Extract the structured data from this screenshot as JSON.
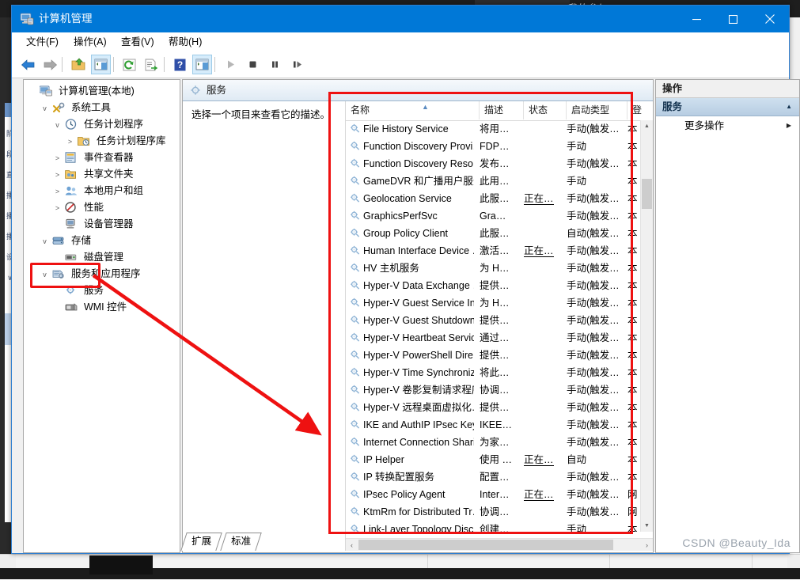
{
  "desktop": {
    "background_tab_label": "我的参与",
    "accent": "#0078d7",
    "annotation_color": "#ee1111"
  },
  "window": {
    "title": "计算机管理",
    "title_icon": "computer-management-icon",
    "controls": {
      "minimize": "—",
      "maximize": "▢",
      "close": "✕"
    }
  },
  "menu": [
    {
      "label": "文件(F)",
      "key": "F"
    },
    {
      "label": "操作(A)",
      "key": "A"
    },
    {
      "label": "查看(V)",
      "key": "V"
    },
    {
      "label": "帮助(H)",
      "key": "H"
    }
  ],
  "toolbar": [
    {
      "name": "back-icon",
      "glyph": "◀"
    },
    {
      "name": "forward-icon",
      "glyph": "▶"
    },
    {
      "name": "up-folder-icon",
      "glyph": ""
    },
    {
      "name": "show-hide-tree-icon",
      "glyph": "",
      "selected": true
    },
    {
      "name": "refresh-icon",
      "glyph": ""
    },
    {
      "name": "export-list-icon",
      "glyph": ""
    },
    {
      "name": "help-icon",
      "glyph": "?"
    },
    {
      "name": "properties-icon",
      "glyph": "",
      "selected": true
    },
    {
      "name": "start-service-icon",
      "glyph": "▶"
    },
    {
      "name": "stop-service-icon",
      "glyph": "■"
    },
    {
      "name": "pause-service-icon",
      "glyph": "❚❚"
    },
    {
      "name": "resume-service-icon",
      "glyph": "❚▶"
    }
  ],
  "tree": [
    {
      "label": "计算机管理(本地)",
      "indent": 0,
      "expander": "",
      "icon": "computer-icon",
      "selected": false
    },
    {
      "label": "系统工具",
      "indent": 1,
      "expander": "v",
      "icon": "system-tools-icon",
      "selected": false
    },
    {
      "label": "任务计划程序",
      "indent": 2,
      "expander": "v",
      "icon": "task-scheduler-icon",
      "selected": false
    },
    {
      "label": "任务计划程序库",
      "indent": 3,
      "expander": ">",
      "icon": "task-library-icon",
      "selected": false
    },
    {
      "label": "事件查看器",
      "indent": 2,
      "expander": ">",
      "icon": "event-viewer-icon",
      "selected": false
    },
    {
      "label": "共享文件夹",
      "indent": 2,
      "expander": ">",
      "icon": "shared-folders-icon",
      "selected": false
    },
    {
      "label": "本地用户和组",
      "indent": 2,
      "expander": ">",
      "icon": "local-users-icon",
      "selected": false
    },
    {
      "label": "性能",
      "indent": 2,
      "expander": ">",
      "icon": "performance-icon",
      "selected": false
    },
    {
      "label": "设备管理器",
      "indent": 2,
      "expander": "",
      "icon": "device-manager-icon",
      "selected": false
    },
    {
      "label": "存储",
      "indent": 1,
      "expander": "v",
      "icon": "storage-icon",
      "selected": false
    },
    {
      "label": "磁盘管理",
      "indent": 2,
      "expander": "",
      "icon": "disk-management-icon",
      "selected": false
    },
    {
      "label": "服务和应用程序",
      "indent": 1,
      "expander": "v",
      "icon": "services-apps-icon",
      "selected": false
    },
    {
      "label": "服务",
      "indent": 2,
      "expander": "",
      "icon": "services-icon",
      "selected": true
    },
    {
      "label": "WMI 控件",
      "indent": 2,
      "expander": "",
      "icon": "wmi-control-icon",
      "selected": false
    }
  ],
  "center": {
    "header_title": "服务",
    "header_icon": "services-icon",
    "description_placeholder": "选择一个项目来查看它的描述。"
  },
  "list": {
    "columns": [
      "名称",
      "描述",
      "状态",
      "启动类型",
      "登"
    ],
    "sort_column": "名称",
    "sort_direction": "asc",
    "rows": [
      {
        "name": "File History Service",
        "desc": "将用…",
        "status": "",
        "startup": "手动(触发…",
        "logon": "本"
      },
      {
        "name": "Function Discovery Provi…",
        "desc": "FDP…",
        "status": "",
        "startup": "手动",
        "logon": "本"
      },
      {
        "name": "Function Discovery Reso…",
        "desc": "发布…",
        "status": "",
        "startup": "手动(触发…",
        "logon": "本"
      },
      {
        "name": "GameDVR 和广播用户服务…",
        "desc": "此用…",
        "status": "",
        "startup": "手动",
        "logon": "本"
      },
      {
        "name": "Geolocation Service",
        "desc": "此服…",
        "status": "正在…",
        "startup": "手动(触发…",
        "logon": "本"
      },
      {
        "name": "GraphicsPerfSvc",
        "desc": "Gra…",
        "status": "",
        "startup": "手动(触发…",
        "logon": "本"
      },
      {
        "name": "Group Policy Client",
        "desc": "此服…",
        "status": "",
        "startup": "自动(触发…",
        "logon": "本"
      },
      {
        "name": "Human Interface Device …",
        "desc": "激活…",
        "status": "正在…",
        "startup": "手动(触发…",
        "logon": "本"
      },
      {
        "name": "HV 主机服务",
        "desc": "为 H…",
        "status": "",
        "startup": "手动(触发…",
        "logon": "本"
      },
      {
        "name": "Hyper-V Data Exchange …",
        "desc": "提供…",
        "status": "",
        "startup": "手动(触发…",
        "logon": "本"
      },
      {
        "name": "Hyper-V Guest Service In…",
        "desc": "为 H…",
        "status": "",
        "startup": "手动(触发…",
        "logon": "本"
      },
      {
        "name": "Hyper-V Guest Shutdown…",
        "desc": "提供…",
        "status": "",
        "startup": "手动(触发…",
        "logon": "本"
      },
      {
        "name": "Hyper-V Heartbeat Service",
        "desc": "通过…",
        "status": "",
        "startup": "手动(触发…",
        "logon": "本"
      },
      {
        "name": "Hyper-V PowerShell Dire…",
        "desc": "提供…",
        "status": "",
        "startup": "手动(触发…",
        "logon": "本"
      },
      {
        "name": "Hyper-V Time Synchroniz…",
        "desc": "将此…",
        "status": "",
        "startup": "手动(触发…",
        "logon": "本"
      },
      {
        "name": "Hyper-V 卷影复制请求程序",
        "desc": "协调…",
        "status": "",
        "startup": "手动(触发…",
        "logon": "本"
      },
      {
        "name": "Hyper-V 远程桌面虚拟化…",
        "desc": "提供…",
        "status": "",
        "startup": "手动(触发…",
        "logon": "本"
      },
      {
        "name": "IKE and AuthIP IPsec Key…",
        "desc": "IKEE…",
        "status": "",
        "startup": "手动(触发…",
        "logon": "本"
      },
      {
        "name": "Internet Connection Shari…",
        "desc": "为家…",
        "status": "",
        "startup": "手动(触发…",
        "logon": "本"
      },
      {
        "name": "IP Helper",
        "desc": "使用 …",
        "status": "正在…",
        "startup": "自动",
        "logon": "本"
      },
      {
        "name": "IP 转换配置服务",
        "desc": "配置…",
        "status": "",
        "startup": "手动(触发…",
        "logon": "本"
      },
      {
        "name": "IPsec Policy Agent",
        "desc": "Inter…",
        "status": "正在…",
        "startup": "手动(触发…",
        "logon": "网"
      },
      {
        "name": "KtmRm for Distributed Tr…",
        "desc": "协调…",
        "status": "",
        "startup": "手动(触发…",
        "logon": "网"
      },
      {
        "name": "Link-Layer Topology Disc…",
        "desc": "创建…",
        "status": "",
        "startup": "手动",
        "logon": "本"
      }
    ]
  },
  "tabs": [
    {
      "label": "扩展",
      "active": false
    },
    {
      "label": "标准",
      "active": true
    }
  ],
  "actions": {
    "header": "操作",
    "group_title": "服务",
    "group_collapse_icon": "chevron-up-icon",
    "items": [
      {
        "label": "更多操作",
        "submenu_icon": "chevron-right-icon"
      }
    ]
  },
  "watermark": "CSDN @Beauty_Ida"
}
